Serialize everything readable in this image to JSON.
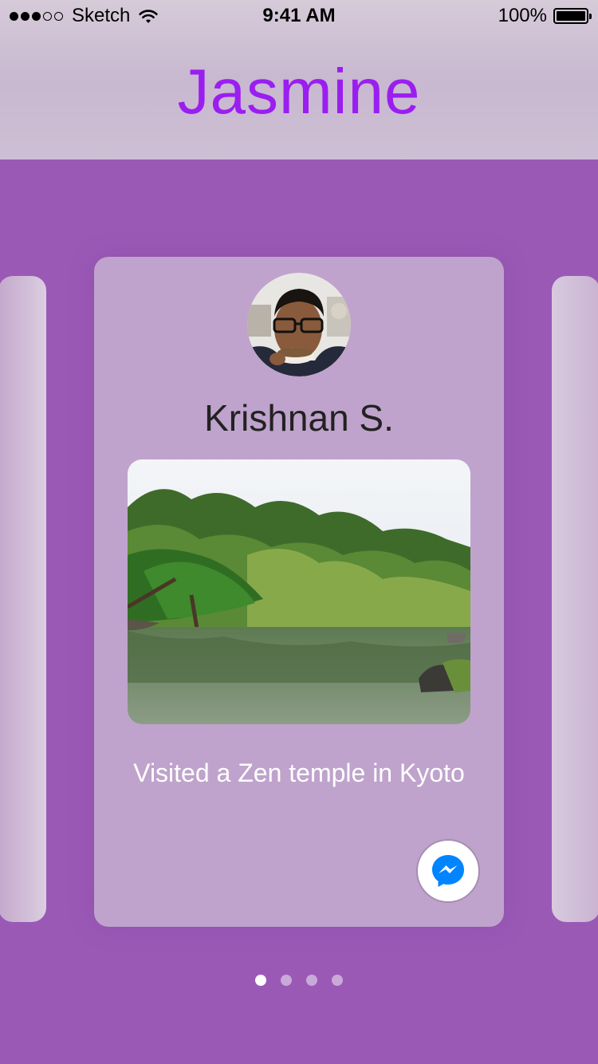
{
  "status_bar": {
    "carrier": "Sketch",
    "time": "9:41 AM",
    "battery": "100%",
    "signal_bars_filled": 3,
    "signal_bars_total": 5,
    "icons": [
      "wifi-icon",
      "battery-icon"
    ]
  },
  "header": {
    "title": "Jasmine",
    "title_color": "#9b1ef0"
  },
  "card": {
    "name": "Krishnan S.",
    "caption": "Visited a Zen temple in Kyoto",
    "avatar_icon": "profile-photo",
    "photo_icon": "zen-garden-photo",
    "action_icon": "messenger-icon",
    "background": "#bfa3cc"
  },
  "pagination": {
    "count": 4,
    "active_index": 0
  },
  "colors": {
    "background": "#9b59b6",
    "messenger_blue": "#0084ff"
  }
}
